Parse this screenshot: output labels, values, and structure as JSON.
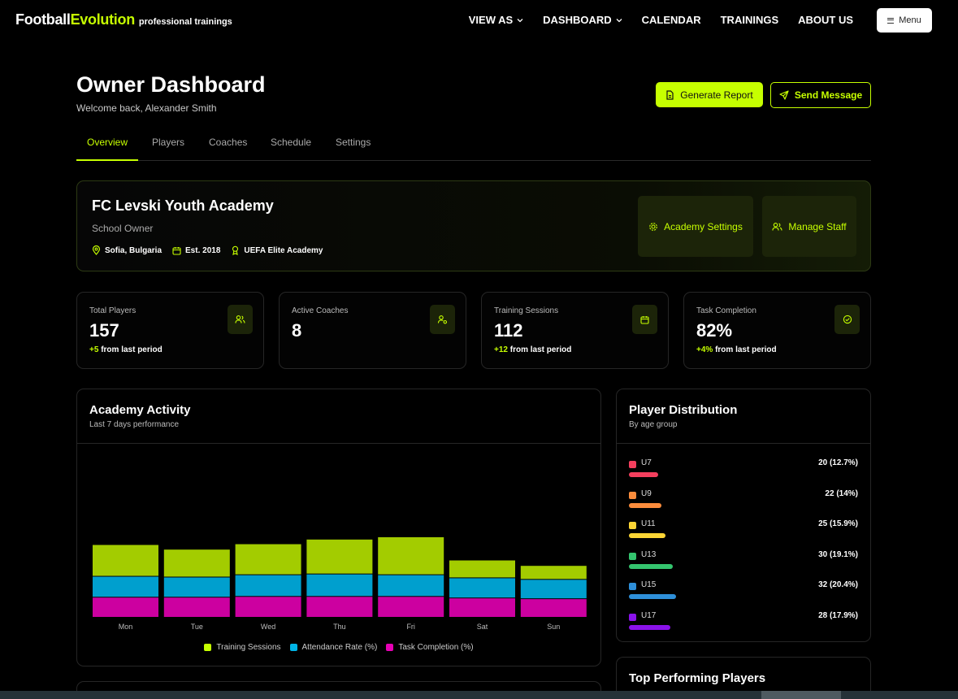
{
  "brand": {
    "part1": "Football",
    "part2": "Evolution",
    "tagline": "professional trainings"
  },
  "nav": {
    "items": [
      {
        "label": "VIEW AS",
        "dropdown": true
      },
      {
        "label": "DASHBOARD",
        "dropdown": true
      },
      {
        "label": "CALENDAR",
        "dropdown": false
      },
      {
        "label": "TRAININGS",
        "dropdown": false
      },
      {
        "label": "ABOUT US",
        "dropdown": false
      }
    ],
    "menu_label": "Menu"
  },
  "header": {
    "title": "Owner Dashboard",
    "welcome": "Welcome back, Alexander Smith",
    "generate_label": "Generate Report",
    "send_label": "Send Message"
  },
  "tabs": [
    {
      "label": "Overview",
      "active": true
    },
    {
      "label": "Players",
      "active": false
    },
    {
      "label": "Coaches",
      "active": false
    },
    {
      "label": "Schedule",
      "active": false
    },
    {
      "label": "Settings",
      "active": false
    }
  ],
  "academy": {
    "name": "FC Levski Youth Academy",
    "role": "School Owner",
    "location": "Sofia, Bulgaria",
    "established": "Est. 2018",
    "accreditation": "UEFA Elite Academy",
    "settings_label": "Academy Settings",
    "staff_label": "Manage Staff"
  },
  "stats": [
    {
      "label": "Total Players",
      "value": "157",
      "delta": "+5",
      "delta_text": "from last period",
      "icon": "users-icon"
    },
    {
      "label": "Active Coaches",
      "value": "8",
      "delta": "",
      "delta_text": "",
      "icon": "coach-icon"
    },
    {
      "label": "Training Sessions",
      "value": "112",
      "delta": "+12",
      "delta_text": "from last period",
      "icon": "calendar-icon"
    },
    {
      "label": "Task Completion",
      "value": "82%",
      "delta": "+4%",
      "delta_text": "from last period",
      "icon": "check-circle-icon"
    }
  ],
  "activity": {
    "title": "Academy Activity",
    "subtitle": "Last 7 days performance"
  },
  "chart_data": {
    "type": "bar",
    "stacked": true,
    "categories": [
      "Mon",
      "Tue",
      "Wed",
      "Thu",
      "Fri",
      "Sat",
      "Sun"
    ],
    "series": [
      {
        "name": "Task Completion",
        "color": "#cc00a0",
        "values": [
          26,
          26,
          27,
          27,
          27,
          25,
          24
        ]
      },
      {
        "name": "Attendance Rate (%)",
        "color": "#009fce",
        "values": [
          27,
          26,
          28,
          29,
          28,
          26,
          25
        ]
      },
      {
        "name": "Training Sessions",
        "color": "#a3cc00",
        "values": [
          41,
          36,
          40,
          45,
          49,
          23,
          18
        ]
      }
    ],
    "legend_order": [
      "Training Sessions",
      "Attendance Rate (%)",
      "Task Completion (%)"
    ],
    "legend_colors": [
      "#c6ff00",
      "#00b4e6",
      "#e600b4"
    ],
    "ylim": [
      0,
      210
    ],
    "grid": false,
    "legend_position": "bottom"
  },
  "distribution": {
    "title": "Player Distribution",
    "subtitle": "By age group",
    "groups": [
      {
        "name": "U7",
        "value": "20 (12.7%)",
        "share": 0.127,
        "color": "#f43f5e"
      },
      {
        "name": "U9",
        "value": "22 (14%)",
        "share": 0.14,
        "color": "#fb8c3c"
      },
      {
        "name": "U11",
        "value": "25 (15.9%)",
        "share": 0.159,
        "color": "#fcd535"
      },
      {
        "name": "U13",
        "value": "30 (19.1%)",
        "share": 0.191,
        "color": "#34c46e"
      },
      {
        "name": "U15",
        "value": "32 (20.4%)",
        "share": 0.204,
        "color": "#2e8fd9"
      },
      {
        "name": "U17",
        "value": "28 (17.9%)",
        "share": 0.179,
        "color": "#8a12ea"
      }
    ]
  },
  "top_players": {
    "title": "Top Performing Players"
  }
}
